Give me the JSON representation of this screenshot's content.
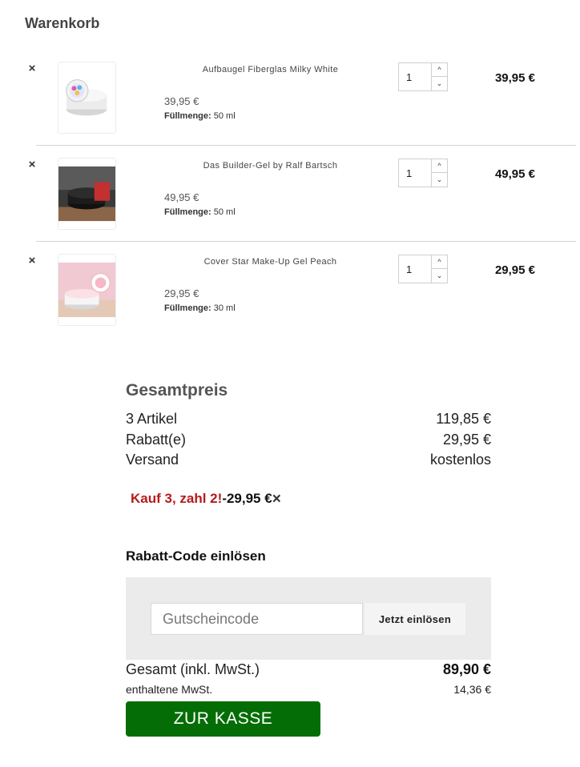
{
  "cart": {
    "title": "Warenkorb",
    "remove_symbol": "×",
    "fill_label": "Füllmenge:",
    "items": [
      {
        "name": "Aufbaugel Fiberglas Milky White",
        "unit_price": "39,95 €",
        "fill_value": "50 ml",
        "quantity": "1",
        "line_total": "39,95 €"
      },
      {
        "name": "Das Builder-Gel by Ralf Bartsch",
        "unit_price": "49,95 €",
        "fill_value": "50 ml",
        "quantity": "1",
        "line_total": "49,95 €"
      },
      {
        "name": "Cover Star Make-Up Gel Peach",
        "unit_price": "29,95 €",
        "fill_value": "30 ml",
        "quantity": "1",
        "line_total": "29,95 €"
      }
    ],
    "stepper": {
      "up": "^",
      "down": "⌄"
    }
  },
  "summary": {
    "title": "Gesamtpreis",
    "rows": [
      {
        "label": "3 Artikel",
        "value": "119,85 €"
      },
      {
        "label": "Rabatt(e)",
        "value": "29,95 €"
      },
      {
        "label": "Versand",
        "value": "kostenlos"
      }
    ],
    "promo": {
      "name": "Kauf 3, zahl 2!",
      "amount": "-29,95 €",
      "remove": "×"
    }
  },
  "coupon": {
    "title": "Rabatt-Code einlösen",
    "placeholder": "Gutscheincode",
    "button": "Jetzt einlösen"
  },
  "totals": {
    "total_label": "Gesamt (inkl. MwSt.)",
    "total_value": "89,90 €",
    "vat_label": "enthaltene MwSt.",
    "vat_value": "14,36 €"
  },
  "checkout": {
    "label": "ZUR KASSE"
  },
  "colors": {
    "checkout_green": "#056d05",
    "promo_red": "#b61b1b"
  }
}
